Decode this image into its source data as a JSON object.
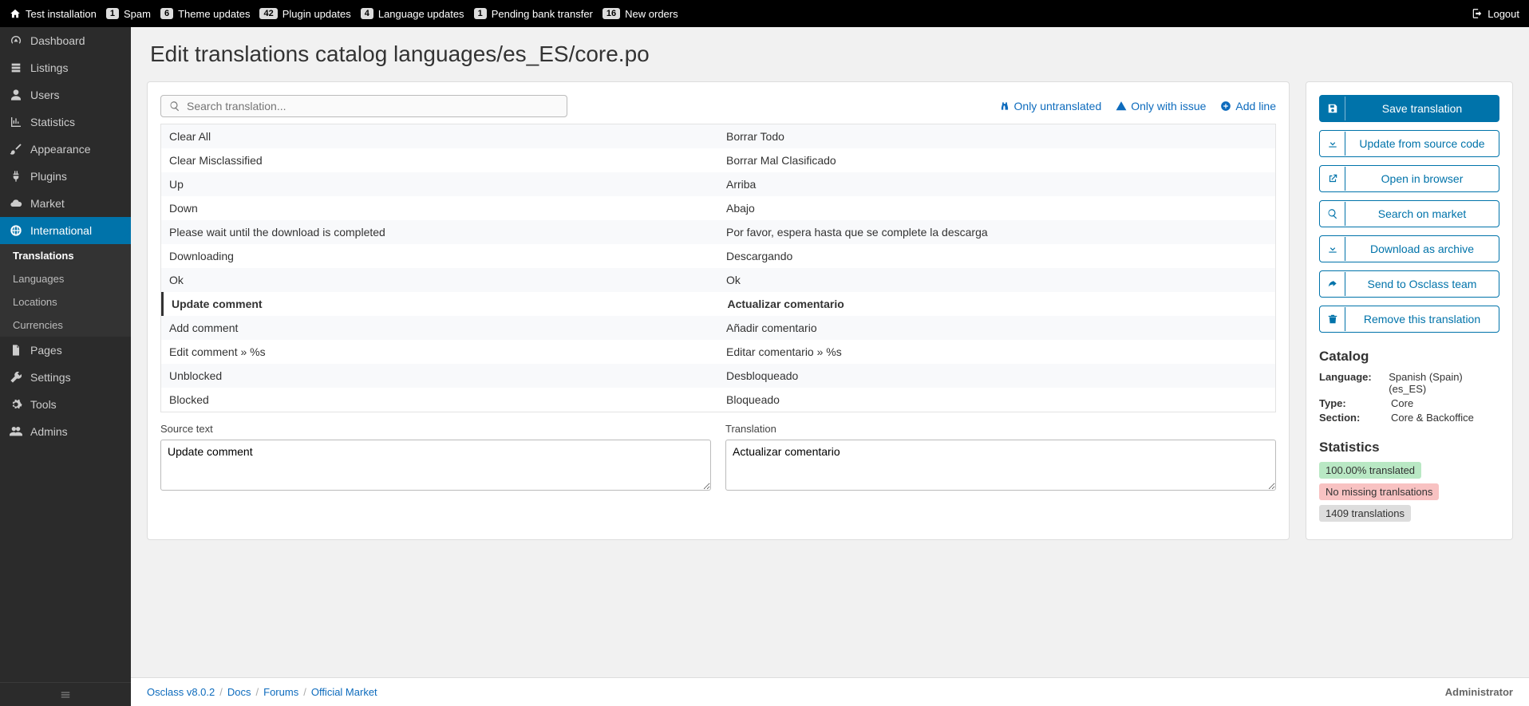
{
  "topbar": {
    "home": "Test installation",
    "items": [
      {
        "badge": "1",
        "label": "Spam"
      },
      {
        "badge": "6",
        "label": "Theme updates"
      },
      {
        "badge": "42",
        "label": "Plugin updates"
      },
      {
        "badge": "4",
        "label": "Language updates"
      },
      {
        "badge": "1",
        "label": "Pending bank transfer"
      },
      {
        "badge": "16",
        "label": "New orders"
      }
    ],
    "logout": "Logout"
  },
  "sidebar": {
    "items": [
      {
        "icon": "gauge",
        "label": "Dashboard"
      },
      {
        "icon": "list",
        "label": "Listings"
      },
      {
        "icon": "user",
        "label": "Users"
      },
      {
        "icon": "chart",
        "label": "Statistics"
      },
      {
        "icon": "brush",
        "label": "Appearance"
      },
      {
        "icon": "plug",
        "label": "Plugins"
      },
      {
        "icon": "cloud",
        "label": "Market"
      },
      {
        "icon": "globe",
        "label": "International",
        "active": true,
        "sub": [
          {
            "label": "Translations",
            "active": true
          },
          {
            "label": "Languages"
          },
          {
            "label": "Locations"
          },
          {
            "label": "Currencies"
          }
        ]
      },
      {
        "icon": "file",
        "label": "Pages"
      },
      {
        "icon": "wrench",
        "label": "Settings"
      },
      {
        "icon": "gear",
        "label": "Tools"
      },
      {
        "icon": "users",
        "label": "Admins"
      }
    ]
  },
  "page": {
    "title": "Edit translations catalog languages/es_ES/core.po"
  },
  "search": {
    "placeholder": "Search translation...",
    "only_untranslated": "Only untranslated",
    "only_with_issue": "Only with issue",
    "add_line": "Add line"
  },
  "translations": [
    {
      "src": "Clear All",
      "tr": "Borrar Todo"
    },
    {
      "src": "Clear Misclassified",
      "tr": "Borrar Mal Clasificado"
    },
    {
      "src": "Up",
      "tr": "Arriba"
    },
    {
      "src": "Down",
      "tr": "Abajo"
    },
    {
      "src": "Please wait until the download is completed",
      "tr": "Por favor, espera hasta que se complete la descarga"
    },
    {
      "src": "Downloading",
      "tr": "Descargando"
    },
    {
      "src": "Ok",
      "tr": "Ok"
    },
    {
      "src": "Update comment",
      "tr": "Actualizar comentario",
      "selected": true
    },
    {
      "src": "Add comment",
      "tr": "Añadir comentario"
    },
    {
      "src": "Edit comment » %s",
      "tr": "Editar comentario » %s"
    },
    {
      "src": "Unblocked",
      "tr": "Desbloqueado"
    },
    {
      "src": "Blocked",
      "tr": "Bloqueado"
    }
  ],
  "editor": {
    "source_label": "Source text",
    "translation_label": "Translation",
    "source_value": "Update comment",
    "translation_value": "Actualizar comentario"
  },
  "right_panel": {
    "buttons": [
      {
        "icon": "save",
        "label": "Save translation",
        "primary": true
      },
      {
        "icon": "download",
        "label": "Update from source code"
      },
      {
        "icon": "ext",
        "label": "Open in browser"
      },
      {
        "icon": "search",
        "label": "Search on market"
      },
      {
        "icon": "archive",
        "label": "Download as archive"
      },
      {
        "icon": "share",
        "label": "Send to Osclass team"
      },
      {
        "icon": "trash",
        "label": "Remove this translation"
      }
    ],
    "catalog_heading": "Catalog",
    "catalog": [
      {
        "k": "Language:",
        "v": "Spanish (Spain) (es_ES)"
      },
      {
        "k": "Type:",
        "v": "Core"
      },
      {
        "k": "Section:",
        "v": "Core & Backoffice"
      }
    ],
    "stats_heading": "Statistics",
    "stats": [
      {
        "text": "100.00% translated",
        "cls": "bg-green"
      },
      {
        "text": "No missing tranlsations",
        "cls": "bg-red"
      },
      {
        "text": "1409 translations",
        "cls": "bg-grey"
      }
    ]
  },
  "footer": {
    "crumbs": [
      "Osclass v8.0.2",
      "Docs",
      "Forums",
      "Official Market"
    ],
    "user": "Administrator"
  }
}
